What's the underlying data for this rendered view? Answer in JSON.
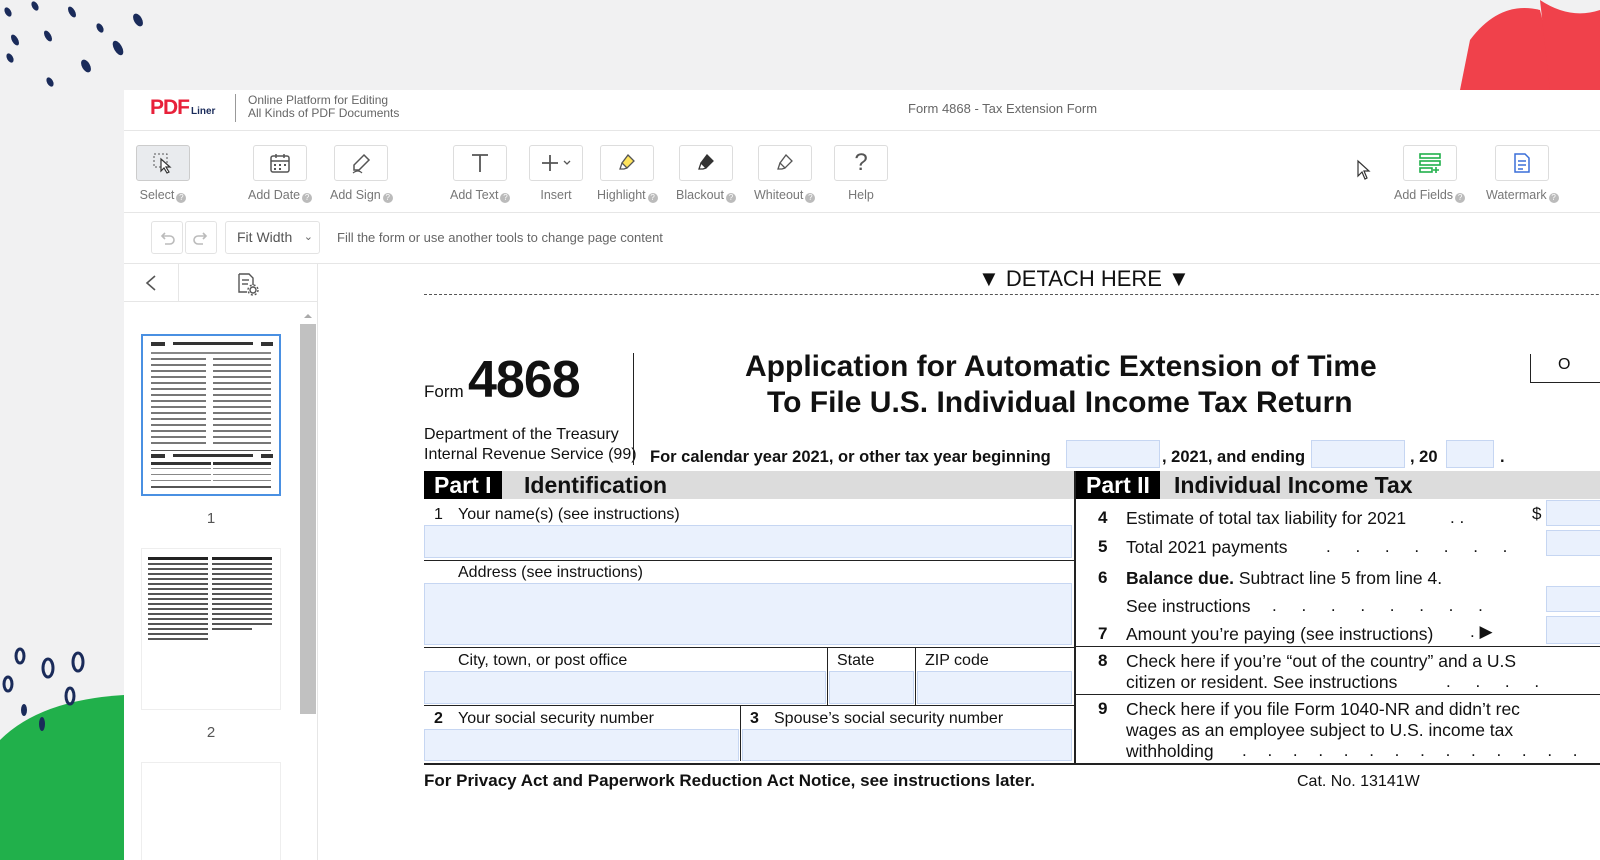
{
  "app": {
    "logo_text": "PDF",
    "logo_sub": "Liner",
    "tagline_1": "Online Platform for Editing",
    "tagline_2": "All Kinds of PDF Documents",
    "doc_title": "Form 4868 - Tax Extension Form"
  },
  "toolbar": {
    "select": "Select",
    "add_date": "Add Date",
    "add_sign": "Add Sign",
    "add_text": "Add Text",
    "insert": "Insert",
    "highlight": "Highlight",
    "blackout": "Blackout",
    "whiteout": "Whiteout",
    "help": "Help",
    "add_fields": "Add Fields",
    "watermark": "Watermark"
  },
  "subbar": {
    "zoom": "Fit Width",
    "hint": "Fill the form or use another tools to change page content"
  },
  "sidebar": {
    "pages": [
      "1",
      "2"
    ]
  },
  "form": {
    "detach": "▼ DETACH HERE ▼",
    "form_word": "Form",
    "form_number": "4868",
    "dept_1": "Department of the Treasury",
    "dept_2": "Internal Revenue Service (99)",
    "title_1": "Application for Automatic Extension of Time",
    "title_2": "To File U.S. Individual Income Tax Return",
    "year_line": "For calendar year 2021, or other tax year beginning",
    "and_ending": ", 2021, and ending",
    "comma_20": ", 20",
    "period": ".",
    "omb_partial": "O",
    "part1_tag": "Part I",
    "part1_title": "Identification",
    "part2_tag": "Part II",
    "part2_title": "Individual Income Tax",
    "l1_num": "1",
    "l1": "Your name(s) (see instructions)",
    "address": "Address (see instructions)",
    "city": "City, town, or post office",
    "state": "State",
    "zip": "ZIP code",
    "l2_num": "2",
    "l2": "Your social security number",
    "l3_num": "3",
    "l3": "Spouse’s social security number",
    "l4_num": "4",
    "l4": "Estimate of total tax liability for 2021",
    "l4_dots": ". .",
    "dollar": "$",
    "l5_num": "5",
    "l5": "Total 2021 payments",
    "l5_dots": ". . . . . . .",
    "l6_num": "6",
    "l6_bold": "Balance due.",
    "l6": " Subtract line 5 from line 4.",
    "l6b": "See instructions",
    "l6b_dots": ". . . . . . . .",
    "l7_num": "7",
    "l7": "Amount you’re paying (see instructions)",
    "l7_arrow": ". ▶",
    "l8_num": "8",
    "l8a": "Check here if you’re “out of the country” and a U.S",
    "l8b": "citizen or resident. See instructions",
    "l8b_dots": ". . . .",
    "l9_num": "9",
    "l9a": "Check here if you file Form 1040-NR and didn’t rec",
    "l9b": "wages as an employee subject to U.S. income tax",
    "l9c": "withholding",
    "l9c_dots": ". . . . . . . . . . . . . .",
    "privacy": "For Privacy Act and Paperwork Reduction Act Notice, see instructions later.",
    "cat": "Cat. No. 13141W"
  }
}
